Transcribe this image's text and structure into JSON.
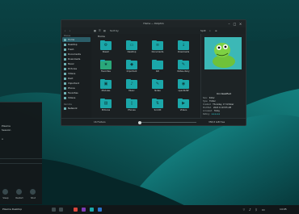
{
  "colors": {
    "accent": "#1ba7a9",
    "window_bg": "#1b2022",
    "taskbar": "#111618"
  },
  "window": {
    "title": "Home — Dolphin",
    "toolbar": {
      "sort": "Sort by",
      "split": "Split"
    },
    "breadcrumb": "Home",
    "sidebar": {
      "places_header": "Places",
      "places": [
        "Home",
        "Desktop",
        "Trash",
        "Documents",
        "Downloads",
        "Music",
        "Pictures",
        "Videos",
        "Root",
        "Important",
        "Phone",
        "Favorites",
        "Videos"
      ],
      "remote_header": "Remote",
      "remote": [
        "Network"
      ]
    },
    "files": [
      {
        "name": "Steam",
        "icon": "steam-icon"
      },
      {
        "name": "Desktop",
        "icon": "desktop-icon"
      },
      {
        "name": "Documents",
        "icon": "document-icon"
      },
      {
        "name": "Downloads",
        "icon": "download-icon"
      },
      {
        "name": "Favorites",
        "icon": "star-icon"
      },
      {
        "name": "Important",
        "icon": "bookmark-icon"
      },
      {
        "name": "Kdl",
        "icon": "folder-icon"
      },
      {
        "name": "Notes-diary",
        "icon": "notes-icon"
      },
      {
        "name": "Modules",
        "icon": "module-icon"
      },
      {
        "name": "Music",
        "icon": "music-icon"
      },
      {
        "name": "Notes",
        "icon": "note-icon"
      },
      {
        "name": "openSUSE",
        "icon": "gecko-icon"
      },
      {
        "name": "Pictures",
        "icon": "picture-icon"
      },
      {
        "name": "Phones",
        "icon": "phone-icon"
      },
      {
        "name": "Scrollit",
        "icon": "scroll-icon"
      },
      {
        "name": "Videos",
        "icon": "video-icon"
      }
    ],
    "status": {
      "left": "16 Folders",
      "right": "358,8 GiB free"
    },
    "info": {
      "name": "Unclassified",
      "rows": [
        {
          "label": "Size:",
          "value": "folder"
        },
        {
          "label": "Type:",
          "value": "Folder"
        },
        {
          "label": "Created:",
          "value": "Thursday, 17 October"
        },
        {
          "label": "Modified:",
          "value": "2024 11:03:55 AM"
        },
        {
          "label": "Accessed:",
          "value": "Today"
        },
        {
          "label": "Rating:",
          "value": "★★★★★"
        }
      ]
    }
  },
  "left_panel": {
    "lines": [
      "Plasma",
      "Session",
      "",
      "u"
    ],
    "actions": [
      "Sleep",
      "Restart",
      "Shut"
    ]
  },
  "taskbar": {
    "launcher": "Plasma Desktop",
    "clock": "14:05"
  }
}
